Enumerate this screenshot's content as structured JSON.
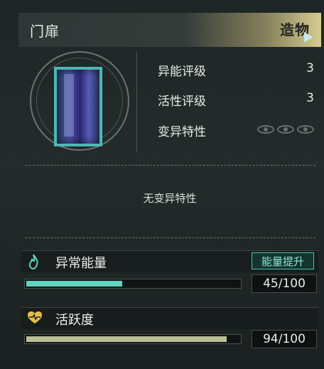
{
  "header": {
    "title": "门扉",
    "tag": "造物"
  },
  "stats": [
    {
      "label": "异能评级",
      "value": "3"
    },
    {
      "label": "活性评级",
      "value": "3"
    },
    {
      "label": "变异特性",
      "value": ""
    }
  ],
  "mutation_text": "无变异特性",
  "energy": {
    "label": "异常能量",
    "button": "能量提升",
    "value_text": "45/100",
    "progress": 0.45,
    "color": "#5fd2c1",
    "icon": "flame-icon"
  },
  "vitality": {
    "label": "活跃度",
    "value_text": "94/100",
    "progress": 0.94,
    "color": "#b9bf96",
    "icon": "heart-pulse-icon"
  }
}
